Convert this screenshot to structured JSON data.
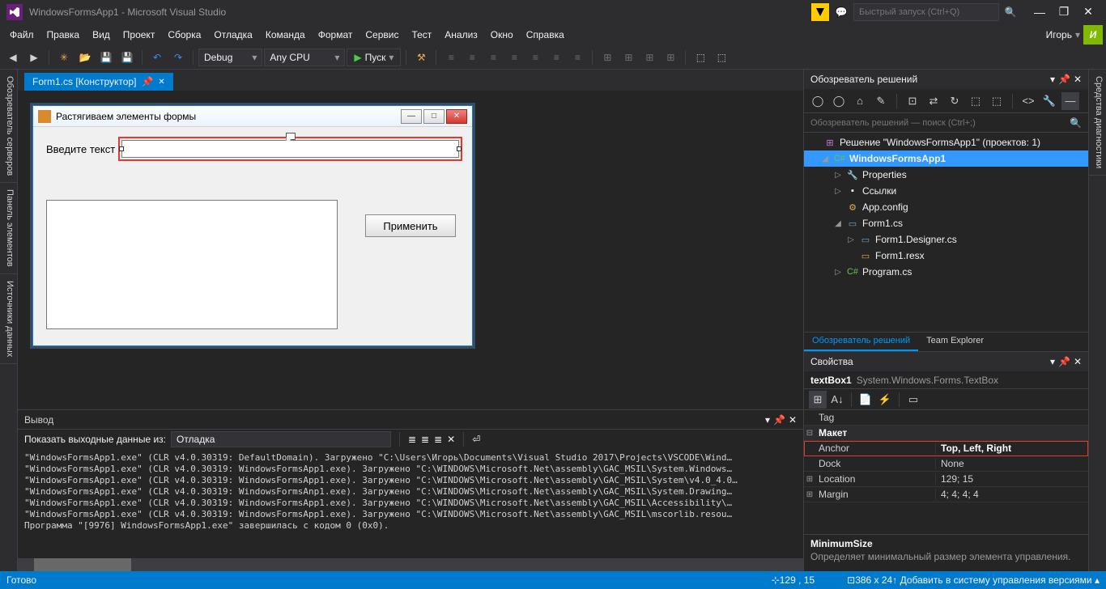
{
  "window": {
    "title": "WindowsFormsApp1 - Microsoft Visual Studio",
    "quick_launch_placeholder": "Быстрый запуск (Ctrl+Q)",
    "user": "Игорь",
    "user_initial": "И"
  },
  "menu": [
    "Файл",
    "Правка",
    "Вид",
    "Проект",
    "Сборка",
    "Отладка",
    "Команда",
    "Формат",
    "Сервис",
    "Тест",
    "Анализ",
    "Окно",
    "Справка"
  ],
  "toolbar": {
    "config": "Debug",
    "platform": "Any CPU",
    "run": "Пуск"
  },
  "left_tabs": [
    "Обозреватель серверов",
    "Панель элементов",
    "Источники данных"
  ],
  "right_tabs": [
    "Средства диагностики"
  ],
  "doc_tab": {
    "label": "Form1.cs [Конструктор]"
  },
  "winform": {
    "title": "Растягиваем элементы формы",
    "label": "Введите текст",
    "apply": "Применить"
  },
  "output": {
    "title": "Вывод",
    "from_label": "Показать выходные данные из:",
    "from": "Отладка",
    "lines": [
      "\"WindowsFormsApp1.exe\" (CLR v4.0.30319: DefaultDomain). Загружено \"C:\\Users\\Игорь\\Documents\\Visual Studio 2017\\Projects\\VSCODE\\Wind…",
      "\"WindowsFormsApp1.exe\" (CLR v4.0.30319: WindowsFormsApp1.exe). Загружено \"C:\\WINDOWS\\Microsoft.Net\\assembly\\GAC_MSIL\\System.Windows…",
      "\"WindowsFormsApp1.exe\" (CLR v4.0.30319: WindowsFormsApp1.exe). Загружено \"C:\\WINDOWS\\Microsoft.Net\\assembly\\GAC_MSIL\\System\\v4.0_4.0…",
      "\"WindowsFormsApp1.exe\" (CLR v4.0.30319: WindowsFormsAnp1.exe). Загружено \"C:\\WINDOWS\\Microsoft.Net\\assembly\\GAC_MSIL\\System.Drawing…",
      "\"WindowsFormsApp1.exe\" (CLR v4.0.30319: WindowsFormsApp1.exe). Загружено \"C:\\WINDOWS\\Microsoft.Net\\assembly\\GAC_MSIL\\Accessibility\\…",
      "\"WindowsFormsApp1.exe\" (CLR v4.0.30319: WindowsFormsApp1.exe). Загружено \"C:\\WINDOWS\\Microsoft.Net\\assembly\\GAC_MSIL\\mscorlib.resou…",
      "Программа \"[9976] WindowsFormsApp1.exe\" завершилась с кодом 0 (0x0)."
    ]
  },
  "solution_explorer": {
    "title": "Обозреватель решений",
    "search_placeholder": "Обозреватель решений — поиск (Ctrl+;)",
    "solution": "Решение \"WindowsFormsApp1\"  (проектов: 1)",
    "project": "WindowsFormsApp1",
    "nodes": {
      "properties": "Properties",
      "references": "Ссылки",
      "appconfig": "App.config",
      "form1": "Form1.cs",
      "designer": "Form1.Designer.cs",
      "resx": "Form1.resx",
      "program": "Program.cs"
    },
    "tabs": {
      "se": "Обозреватель решений",
      "te": "Team Explorer"
    }
  },
  "properties": {
    "title": "Свойства",
    "selected_name": "textBox1",
    "selected_type": "System.Windows.Forms.TextBox",
    "rows": {
      "tag": {
        "name": "Tag",
        "value": ""
      },
      "cat": {
        "name": "Макет"
      },
      "anchor": {
        "name": "Anchor",
        "value": "Top, Left, Right"
      },
      "dock": {
        "name": "Dock",
        "value": "None"
      },
      "location": {
        "name": "Location",
        "value": "129; 15"
      },
      "margin": {
        "name": "Margin",
        "value": "4; 4; 4; 4"
      }
    },
    "desc": {
      "name": "MinimumSize",
      "text": "Определяет минимальный размер элемента управления."
    }
  },
  "statusbar": {
    "ready": "Готово",
    "pos": "129 , 15",
    "size": "386 x 24",
    "vcs": "Добавить в систему управления версиями"
  }
}
